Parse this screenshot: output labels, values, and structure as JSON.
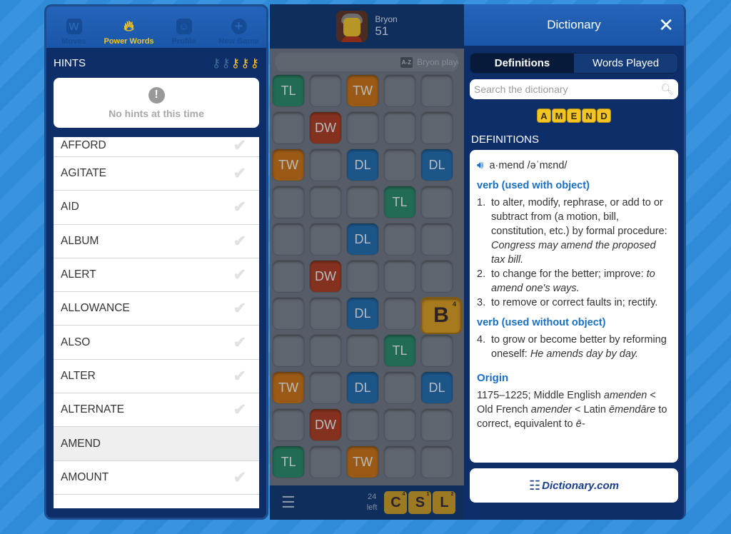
{
  "left_panel": {
    "nav": [
      {
        "label": "Moves",
        "icon": "W",
        "active": false
      },
      {
        "label": "Power Words",
        "icon": "flame",
        "active": true
      },
      {
        "label": "Profile",
        "icon": "face",
        "active": false
      },
      {
        "label": "New Game",
        "icon": "+",
        "active": false
      }
    ],
    "hints_title": "HINTS",
    "keys": {
      "used": 2,
      "available": 3
    },
    "no_hints_text": "No hints at this time",
    "words": [
      {
        "word": "AFFORD",
        "checked": true
      },
      {
        "word": "AGITATE",
        "checked": true
      },
      {
        "word": "AID",
        "checked": true
      },
      {
        "word": "ALBUM",
        "checked": true
      },
      {
        "word": "ALERT",
        "checked": true
      },
      {
        "word": "ALLOWANCE",
        "checked": true
      },
      {
        "word": "ALSO",
        "checked": true
      },
      {
        "word": "ALTER",
        "checked": true
      },
      {
        "word": "ALTERNATE",
        "checked": true
      },
      {
        "word": "AMEND",
        "checked": false,
        "selected": true
      },
      {
        "word": "AMOUNT",
        "checked": true
      }
    ]
  },
  "game": {
    "player_name": "Bryon",
    "player_score": "51",
    "play_bar_icon": "A-Z",
    "play_bar_text": "Bryon played",
    "board": [
      [
        "TL",
        "",
        "TW",
        "",
        ""
      ],
      [
        "",
        "DW",
        "",
        "",
        ""
      ],
      [
        "TW",
        "",
        "DL",
        "",
        "DL"
      ],
      [
        "",
        "",
        "",
        "TL",
        ""
      ],
      [
        "",
        "",
        "DL",
        "",
        ""
      ],
      [
        "",
        "DW",
        "",
        "",
        ""
      ],
      [
        "",
        "",
        "DL",
        "",
        "B"
      ],
      [
        "",
        "",
        "",
        "TL",
        ""
      ],
      [
        "TW",
        "",
        "DL",
        "",
        "DL"
      ],
      [
        "",
        "DW",
        "",
        "",
        ""
      ],
      [
        "TL",
        "",
        "TW",
        "",
        ""
      ]
    ],
    "placed_tile": {
      "letter": "B",
      "value": "4"
    },
    "tiles_left_count": "24",
    "tiles_left_label": "left",
    "rack": [
      {
        "letter": "C",
        "value": "4"
      },
      {
        "letter": "S",
        "value": "1"
      },
      {
        "letter": "L",
        "value": "2"
      }
    ]
  },
  "dictionary": {
    "title": "Dictionary",
    "close_label": "✕",
    "tabs": {
      "definitions": "Definitions",
      "words_played": "Words Played"
    },
    "search_placeholder": "Search the dictionary",
    "word_tiles": [
      "A",
      "M",
      "E",
      "N",
      "D"
    ],
    "definitions_label": "DEFINITIONS",
    "pronunciation": "a·mend /əˈmɛnd/",
    "senses": [
      {
        "pos": "verb (used with object)",
        "items": [
          {
            "num": "1.",
            "text": "to alter, modify, rephrase, or add to or subtract from (a motion, bill, constitution, etc.) by formal procedure: ",
            "example": "Congress may amend the proposed tax bill."
          },
          {
            "num": "2.",
            "text": "to change for the better; improve: ",
            "example": "to amend one's ways."
          },
          {
            "num": "3.",
            "text": "to remove or correct faults in; rectify.",
            "example": ""
          }
        ]
      },
      {
        "pos": "verb (used without object)",
        "items": [
          {
            "num": "4.",
            "text": "to grow or become better by reforming oneself: ",
            "example": "He amends day by day."
          }
        ]
      }
    ],
    "origin_label": "Origin",
    "origin": {
      "part1": "1175–1225; Middle English ",
      "em1": "amenden",
      "part2": " < Old French ",
      "em2": "amender",
      "part3": " < Latin ",
      "em3": "ēmendāre",
      "part4": " to correct, equivalent to ",
      "em4": "ē-"
    },
    "footer_logo": "Dictionary.com"
  }
}
